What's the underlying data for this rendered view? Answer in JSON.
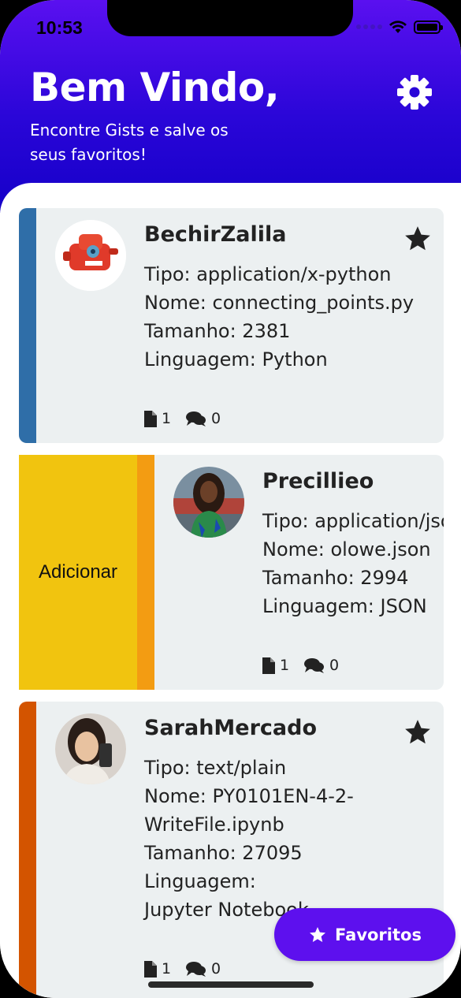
{
  "status_bar": {
    "time": "10:53"
  },
  "header": {
    "title": "Bem Vindo,",
    "subtitle": "Encontre Gists e salve os seus favoritos!",
    "settings_icon": "gear-icon",
    "background_color": "#3a08e0"
  },
  "gists": [
    {
      "owner": "BechirZalila",
      "tipo": "Tipo: application/x-python",
      "nome": "Nome: connecting_points.py",
      "tamanho": "Tamanho: 2381",
      "linguagem": "Linguagem: Python",
      "files": "1",
      "comments": "0",
      "favorited": true,
      "accent_color": "#2f6ea8"
    },
    {
      "owner": "Precillieo",
      "tipo": "Tipo: application/json",
      "nome": "Nome: olowe.json",
      "tamanho": "Tamanho: 2994",
      "linguagem": "Linguagem: JSON",
      "files": "1",
      "comments": "0",
      "favorited": false,
      "accent_color": "#f39c12",
      "swipe_action_label": "Adicionar",
      "swipe_action_color": "#f1c40f"
    },
    {
      "owner": "SarahMercado",
      "tipo": "Tipo: text/plain",
      "nome_line1": "Nome: PY0101EN-4-2-",
      "nome_line2": "WriteFile.ipynb",
      "tamanho": "Tamanho: 27095",
      "linguagem_line1": "Linguagem:",
      "linguagem_line2": "Jupyter Notebook",
      "files": "1",
      "comments": "0",
      "favorited": true,
      "accent_color": "#d35400"
    }
  ],
  "fab": {
    "label": "Favoritos",
    "icon": "star-icon",
    "color": "#5d10ee"
  }
}
